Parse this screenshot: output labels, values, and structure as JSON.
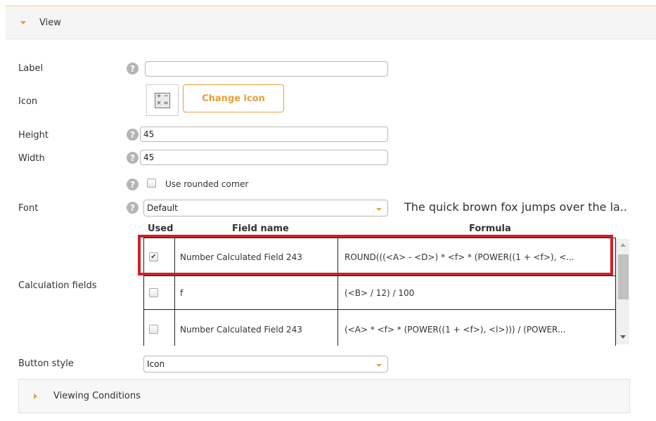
{
  "colors": {
    "accent": "#e8a13b",
    "highlight": "#cc2229",
    "help_icon": "#b5b5b5"
  },
  "view_section": {
    "title": "View",
    "icon": "caret-down-icon"
  },
  "fields": {
    "label": {
      "label": "Label",
      "value": ""
    },
    "icon": {
      "label": "Icon",
      "current_icon": "calculator-icon",
      "button": "Change icon"
    },
    "height": {
      "label": "Height",
      "value": "45"
    },
    "width": {
      "label": "Width",
      "value": "45"
    },
    "rounded": {
      "label": "Use rounded corner",
      "checked": false
    },
    "font": {
      "label": "Font",
      "value": "Default",
      "preview": "The quick brown fox jumps over the la.."
    },
    "calc": {
      "label": "Calculation fields",
      "columns": {
        "used": "Used",
        "field_name": "Field name",
        "formula": "Formula"
      },
      "rows": [
        {
          "used": true,
          "mark": "✔",
          "name": "Number Calculated Field 243",
          "formula": "ROUND(((<A> - <D>) * <f> * (POWER((1 + <f>), <..."
        },
        {
          "used": false,
          "mark": "",
          "name": "f",
          "formula": "(<B> / 12) / 100"
        },
        {
          "used": false,
          "mark": "",
          "name": "Number Calculated Field 243",
          "formula": "(<A> * <f> * (POWER((1 + <f>), <l>))) / (POWER..."
        }
      ]
    },
    "button_style": {
      "label": "Button style",
      "value": "Icon"
    }
  },
  "viewing_conditions": {
    "title": "Viewing Conditions",
    "icon": "caret-right-icon"
  }
}
